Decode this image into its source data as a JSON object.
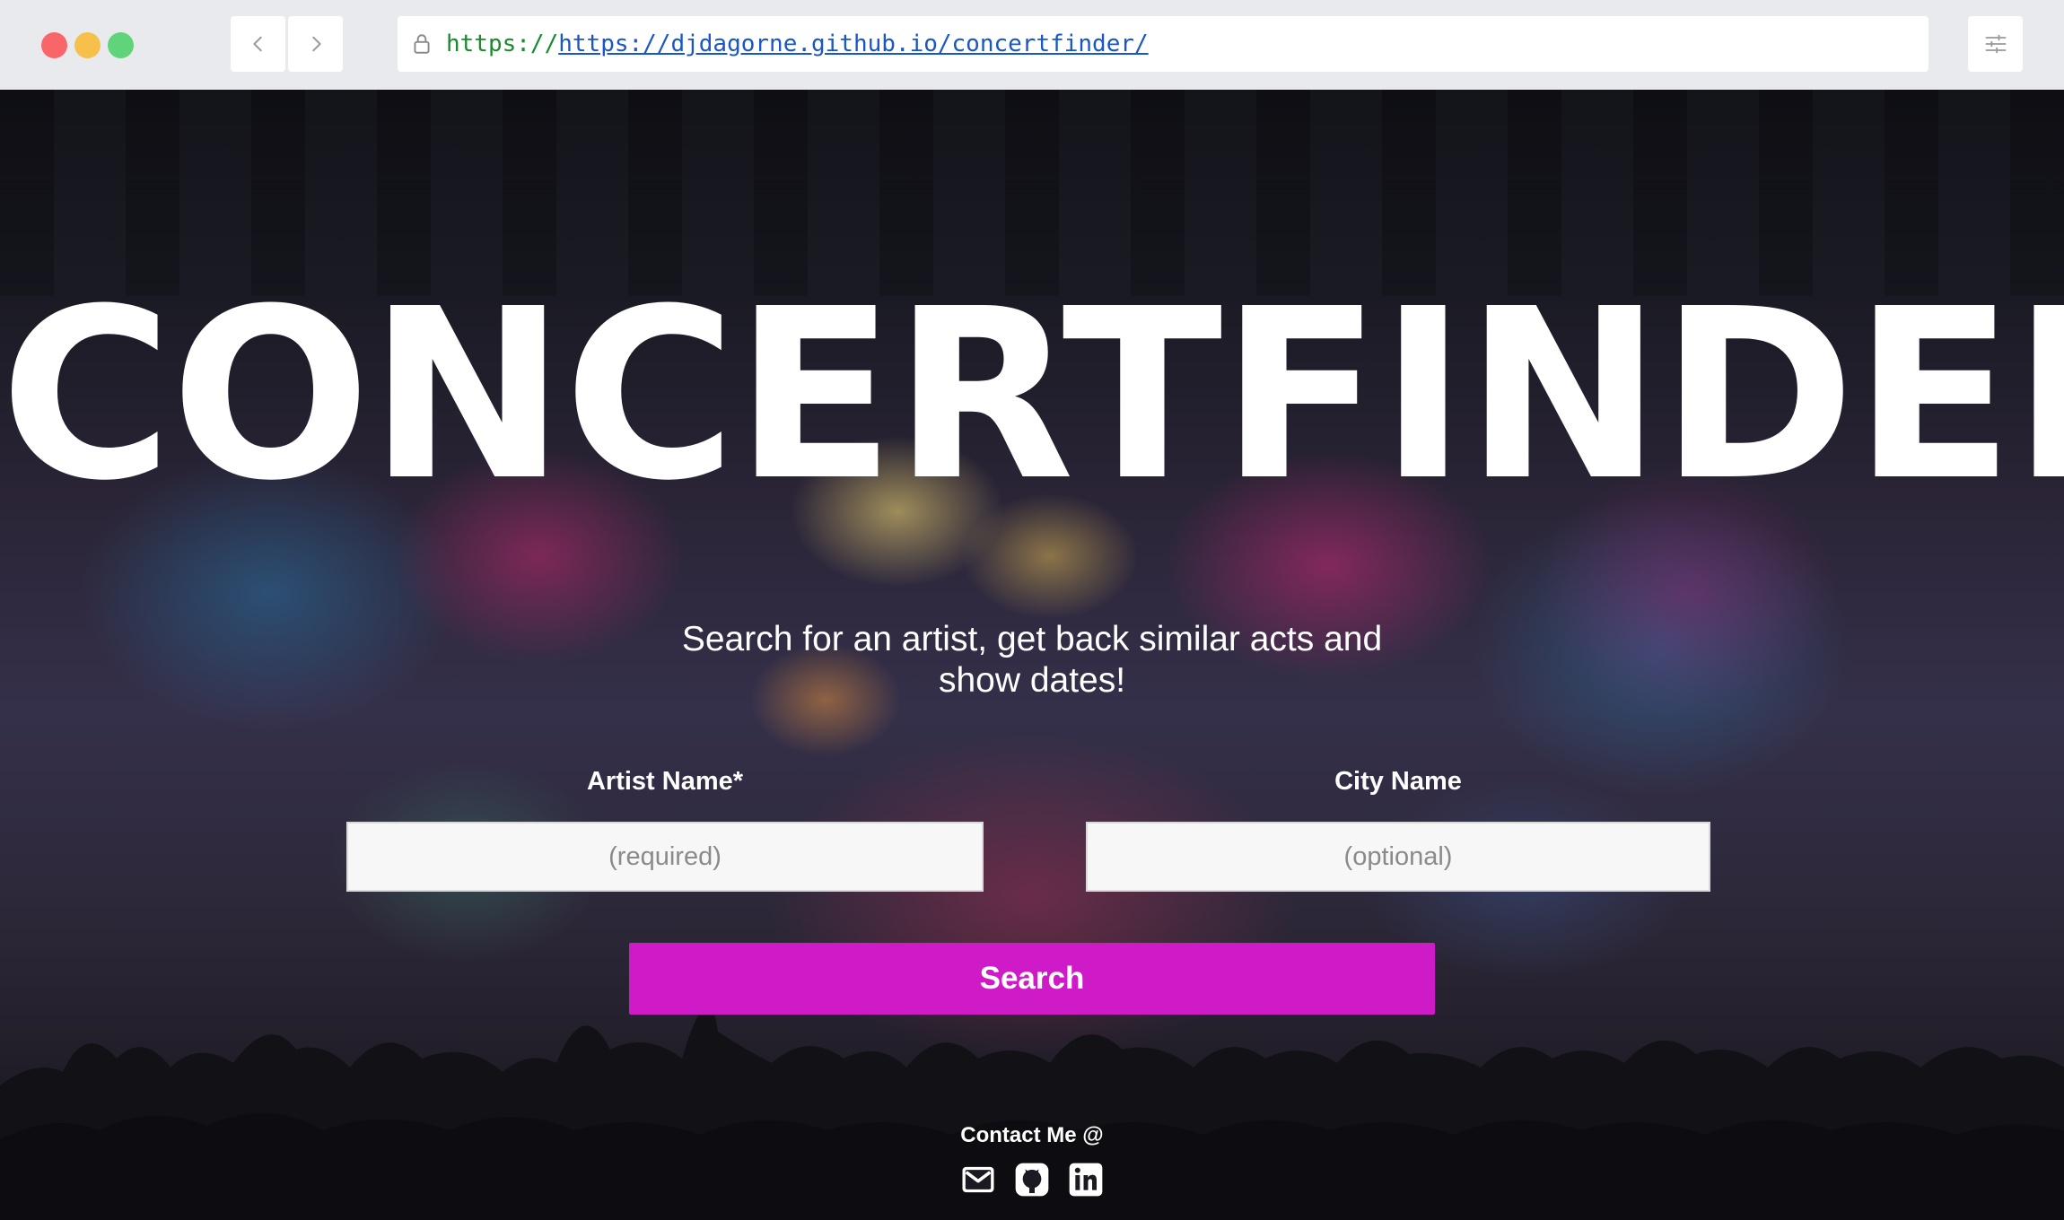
{
  "browser": {
    "url_scheme": "https://",
    "url": "https://djdagorne.github.io/concertfinder/",
    "icons": [
      "back-arrow-icon",
      "forward-arrow-icon",
      "lock-icon",
      "settings-sliders-icon"
    ]
  },
  "page": {
    "title": "CONCERTFINDER",
    "tagline": "Search for an artist, get back similar acts and show dates!",
    "form": {
      "artist_label": "Artist Name*",
      "artist_placeholder": "(required)",
      "artist_value": "",
      "city_label": "City Name",
      "city_placeholder": "(optional)",
      "city_value": "",
      "search_label": "Search"
    },
    "contact": {
      "label": "Contact Me @",
      "icons": [
        "email-icon",
        "github-icon",
        "linkedin-icon"
      ]
    },
    "colors": {
      "accent_button": "#cf1ac8",
      "text": "#ffffff",
      "url_scheme": "#1a8a2e",
      "url_link": "#1a56c8"
    }
  }
}
